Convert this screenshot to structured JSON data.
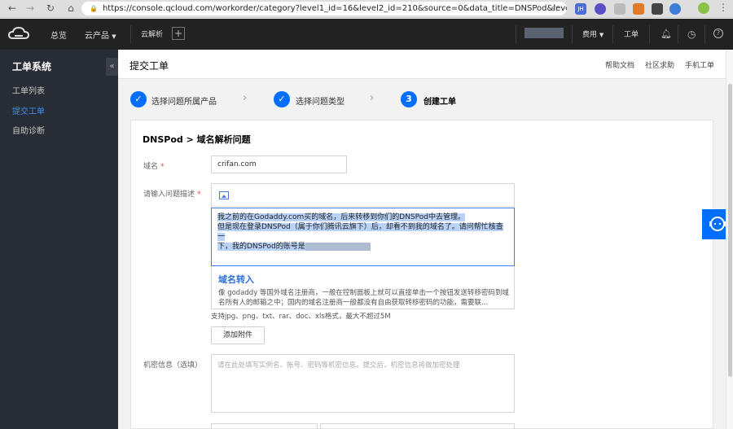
{
  "browser": {
    "url": "https://console.qcloud.com/workorder/category?level1_id=16&level2_id=210&source=0&data_title=DNSPod&level...",
    "extensions": [
      "JH",
      "",
      "",
      "",
      "",
      ""
    ]
  },
  "topbar": {
    "overview": "总览",
    "products": "云产品",
    "dns": "云解析",
    "billing": "费用",
    "workorder": "工单"
  },
  "sidebar": {
    "title": "工单系统",
    "items": [
      {
        "label": "工单列表"
      },
      {
        "label": "提交工单"
      },
      {
        "label": "自助诊断"
      }
    ]
  },
  "header": {
    "title": "提交工单",
    "links": [
      "帮助文档",
      "社区求助",
      "手机工单"
    ]
  },
  "steps": [
    {
      "label": "选择问题所属产品",
      "mark": "✓"
    },
    {
      "label": "选择问题类型",
      "mark": "✓"
    },
    {
      "label": "创建工单",
      "mark": "3"
    }
  ],
  "form": {
    "title": "DNSPod > 域名解析问题",
    "domain_label": "域名",
    "required_mark": "*",
    "domain_value": "crifan.com",
    "desc_label": "请输入问题描述",
    "desc_line1": "我之前的在Godaddy.com买的域名，后来转移到你们的DNSPod中去管理。",
    "desc_line2": "但是现在登录DNSPod（属于你们腾讯云旗下）后，却看不到我的域名了。请问帮忙核查一",
    "desc_line3": "下，我的DNSPod的账号是",
    "kb_title": "域名转入",
    "kb_text": "像 godaddy 等国外域名注册商，一般在控制面板上就可以直接单击一个按钮发送转移密码到域名所有人的邮箱之中；国内的域名注册商一般都没有自由获取转移密码的功能，需要联...",
    "upload_hint": "支持jpg、png、txt、rar、doc、xls格式，最大不超过5M",
    "attach_button": "添加附件",
    "secret_label": "机密信息（选填）",
    "secret_placeholder": "请在此处填写实例名、账号、密码等机密信息。提交后，机密信息将做加密处理"
  }
}
